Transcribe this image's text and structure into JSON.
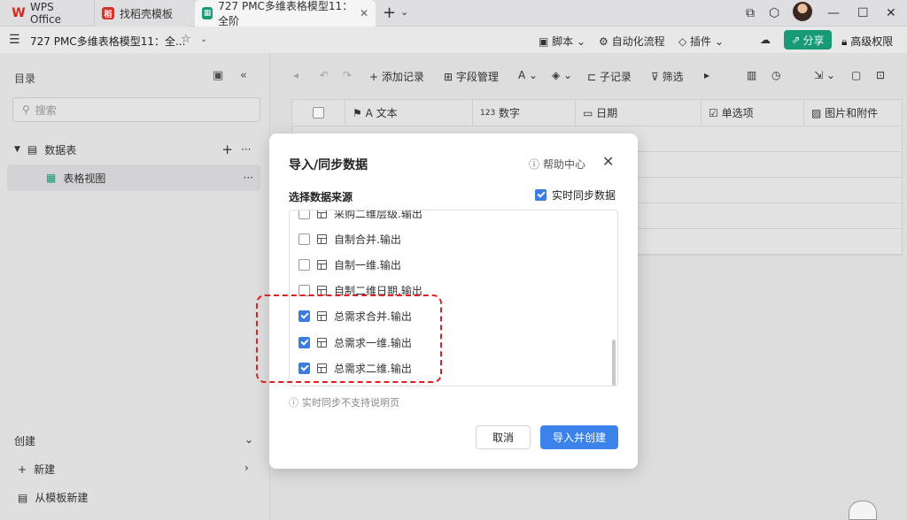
{
  "titlebar": {
    "tabs": [
      {
        "label": "WPS Office"
      },
      {
        "label": "找稻壳模板"
      },
      {
        "label": "727 PMC多维表格模型11：全阶"
      }
    ],
    "add_tab": "+",
    "more": "⌄"
  },
  "docbar": {
    "title": "727 PMC多维表格模型11：全...",
    "tools": [
      "脚本",
      "自动化流程",
      "插件"
    ],
    "share": "分享",
    "permission": "高级权限"
  },
  "sidebar": {
    "title": "目录",
    "search_placeholder": "搜索",
    "tree": {
      "table": "数据表",
      "view": "表格视图"
    },
    "bottom": {
      "section": "创建",
      "new": "新建",
      "from_template": "从模板新建"
    }
  },
  "toolbar": {
    "add_record": "添加记录",
    "field_manage": "字段管理",
    "sub_record": "子记录",
    "filter": "筛选"
  },
  "grid": {
    "columns": [
      {
        "icon": "text-icon",
        "label": "A 文本"
      },
      {
        "icon": "number-icon",
        "label": "数字",
        "prefix": "123"
      },
      {
        "icon": "date-icon",
        "label": "日期"
      },
      {
        "icon": "select-icon",
        "label": "单选项"
      },
      {
        "icon": "image-icon",
        "label": "图片和附件"
      }
    ]
  },
  "dialog": {
    "title": "导入/同步数据",
    "help": "帮助中心",
    "subtitle": "选择数据来源",
    "realtime_sync": {
      "label": "实时同步数据",
      "checked": true
    },
    "items": [
      {
        "label": "采购二维层级.输出",
        "checked": false
      },
      {
        "label": "自制合并.输出",
        "checked": false
      },
      {
        "label": "自制一维.输出",
        "checked": false
      },
      {
        "label": "自制二维日期.输出",
        "checked": false
      },
      {
        "label": "总需求合并.输出",
        "checked": true
      },
      {
        "label": "总需求一维.输出",
        "checked": true
      },
      {
        "label": "总需求二维.输出",
        "checked": true
      }
    ],
    "note": "实时同步不支持说明页",
    "cancel": "取消",
    "confirm": "导入并创建"
  },
  "colors": {
    "accent": "#3b83ea",
    "brand": "#1aa17b",
    "annotation": "#e02020"
  }
}
